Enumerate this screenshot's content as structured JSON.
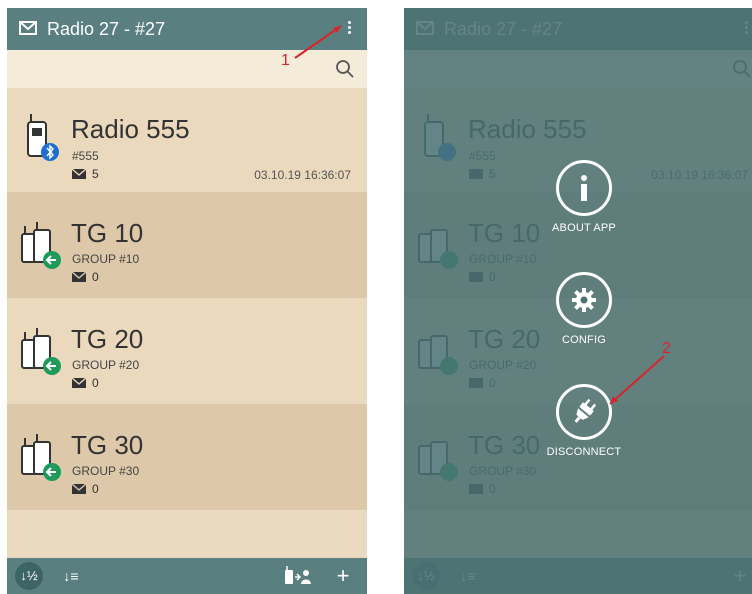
{
  "app": {
    "title": "Radio 27 - #27"
  },
  "items": [
    {
      "name": "Radio 555",
      "subtitle": "#555",
      "messages": "5",
      "timestamp": "03.10.19 16:36:07",
      "status": "bluetooth"
    },
    {
      "name": "TG 10",
      "subtitle": "GROUP #10",
      "messages": "0",
      "status": "incoming"
    },
    {
      "name": "TG 20",
      "subtitle": "GROUP #20",
      "messages": "0",
      "status": "incoming"
    },
    {
      "name": "TG 30",
      "subtitle": "GROUP #30",
      "messages": "0",
      "status": "incoming"
    }
  ],
  "bottom": {
    "sort_label": "↓½",
    "sort2_label": "↓≡",
    "add_label": "+"
  },
  "menu": [
    {
      "label": "ABOUT APP",
      "icon": "info-icon"
    },
    {
      "label": "CONFIG",
      "icon": "gear-icon"
    },
    {
      "label": "DISCONNECT",
      "icon": "plug-icon"
    }
  ],
  "annotations": {
    "one": "1",
    "two": "2"
  },
  "colors": {
    "appbar": "#5a7f80",
    "accent_blue": "#1d6fd1",
    "accent_green": "#1f9a5a",
    "annotation": "#d7262b"
  }
}
